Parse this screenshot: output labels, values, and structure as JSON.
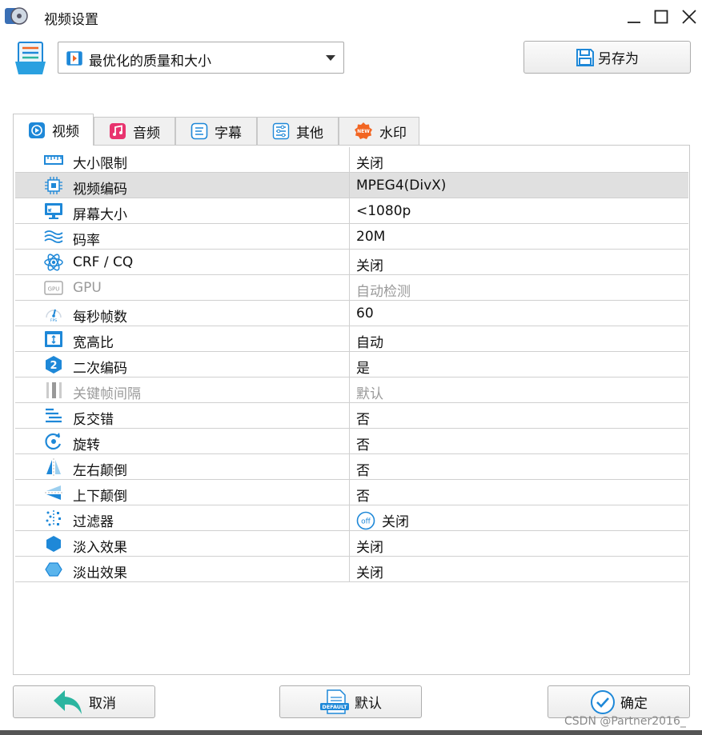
{
  "window": {
    "title": "视频设置"
  },
  "profile": {
    "selected": "最优化的质量和大小",
    "save_as_label": "另存为"
  },
  "tabs": [
    {
      "label": "视频",
      "active": true
    },
    {
      "label": "音频",
      "active": false
    },
    {
      "label": "字幕",
      "active": false
    },
    {
      "label": "其他",
      "active": false
    },
    {
      "label": "水印",
      "active": false
    }
  ],
  "settings": [
    {
      "label": "大小限制",
      "value": "关闭",
      "icon": "ruler-icon"
    },
    {
      "label": "视频编码",
      "value": "MPEG4(DivX)",
      "icon": "chip-icon",
      "selected": true
    },
    {
      "label": "屏幕大小",
      "value": "<1080p",
      "icon": "monitor-icon"
    },
    {
      "label": "码率",
      "value": "20M",
      "icon": "waves-icon"
    },
    {
      "label": "CRF / CQ",
      "value": "关闭",
      "icon": "atom-icon"
    },
    {
      "label": "GPU",
      "value": "自动检测",
      "icon": "gpu-icon",
      "disabled": true
    },
    {
      "label": "每秒帧数",
      "value": "60",
      "icon": "fps-gauge-icon"
    },
    {
      "label": "宽高比",
      "value": "自动",
      "icon": "aspect-ratio-icon"
    },
    {
      "label": "二次编码",
      "value": "是",
      "icon": "two-pass-icon"
    },
    {
      "label": "关键帧间隔",
      "value": "默认",
      "icon": "keyframe-icon",
      "disabled": true
    },
    {
      "label": "反交错",
      "value": "否",
      "icon": "deinterlace-icon"
    },
    {
      "label": "旋转",
      "value": "否",
      "icon": "rotate-icon"
    },
    {
      "label": "左右颠倒",
      "value": "否",
      "icon": "flip-horizontal-icon"
    },
    {
      "label": "上下颠倒",
      "value": "否",
      "icon": "flip-vertical-icon"
    },
    {
      "label": "过滤器",
      "value": "关闭",
      "icon": "filter-icon",
      "badge": "off"
    },
    {
      "label": "淡入效果",
      "value": "关闭",
      "icon": "fade-in-icon"
    },
    {
      "label": "淡出效果",
      "value": "关闭",
      "icon": "fade-out-icon"
    }
  ],
  "buttons": {
    "cancel": "取消",
    "default": "默认",
    "ok": "确定",
    "default_icon_text": "DEFAULT"
  },
  "tab_badges": {
    "watermark_new": "NEW",
    "gpu_chip": "GPU",
    "fps_label": "FPS",
    "two_pass_digit": "2"
  },
  "watermark": "CSDN @Partner2016_",
  "colors": {
    "accent": "#1e88d8",
    "teal": "#2bb5a0",
    "music": "#e8336e",
    "new_badge": "#f26522"
  }
}
